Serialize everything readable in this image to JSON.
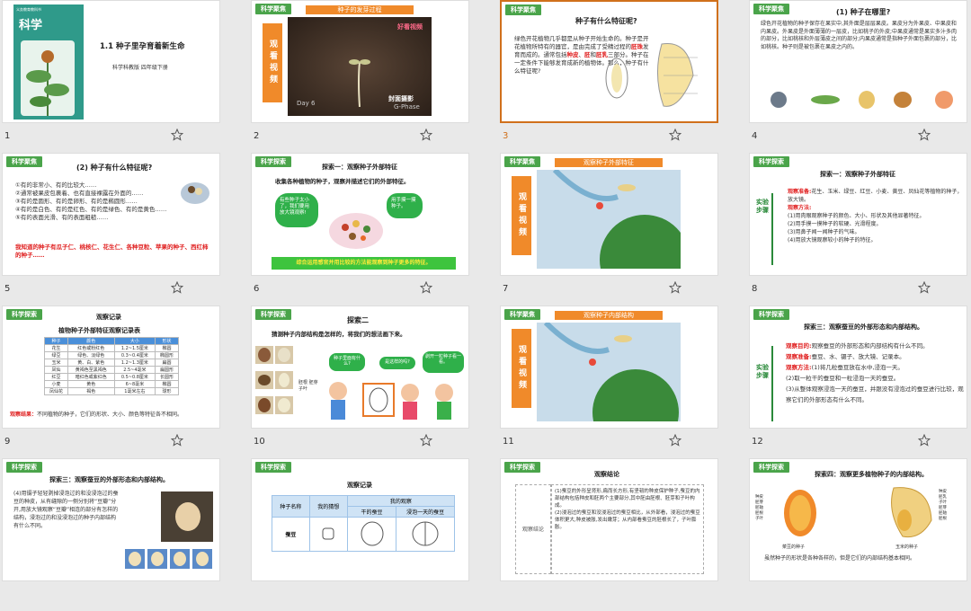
{
  "slides": [
    {
      "num": "1",
      "book_title": "科学",
      "publisher_small": "义务教育教科书",
      "title": "1.1 种子里孕育着新生命",
      "sub": "科学科教版   四年级下册"
    },
    {
      "num": "2",
      "tag": "科学聚焦",
      "bar": "种子的发芽过程",
      "side": "观看视频",
      "video_day": "Day 6",
      "video_credit": "封面摄影",
      "video_brand": "G-Phase",
      "logo": "好看视频"
    },
    {
      "num": "3",
      "tag": "科学聚焦",
      "title": "种子有什么特征呢?",
      "body_a": "绿色开花植物几乎都是从种子开始生命的。种子是开花植物所特有的器官，是由完成了受精过程的",
      "body_r1": "胚珠",
      "body_b": "发育而成的。通常包括",
      "body_r2": "种皮",
      "body_c": "、",
      "body_r3": "胚",
      "body_d": "和",
      "body_r4": "胚乳",
      "body_e": "三部分。种子在一定条件下能够发育成新的植物体。那么，种子有什么特征呢?"
    },
    {
      "num": "4",
      "tag": "科学聚焦",
      "title": "(1) 种子在哪里?",
      "body": "绿色开花植物的种子保存在果实中,其外面是层层果皮。果皮分为外果皮、中果皮和内果皮。外果皮是外面薄薄的一层皮，比如桃子的外皮;中果皮通常是果实多汁多肉的部分，比如桃核和外层薄皮之间的部分;内果皮通常是指种子外面包裹的部分，比如桃核。种子则是被包裹在果皮之内的。"
    },
    {
      "num": "5",
      "tag": "科学聚焦",
      "title": "(2) 种子有什么特征呢?",
      "items": [
        "①有的非常小、有的比较大……",
        "②通常被果皮包裹着、也有直接裸露在外面的……",
        "③有的是圆形、有的是卵形、有的是椭圆形……",
        "④有的是白色、有的是红色、有的是绿色、有的是黄色……",
        "⑤有的表面光滑、有的表面粗糙……"
      ],
      "note": "我知道的种子有瓜子仁、桃核仁、花生仁、各种豆粒、苹果的种子、西红柿的种子……"
    },
    {
      "num": "6",
      "tag": "科学探索",
      "title": "探索一：观察种子外部特征",
      "intro": "收集各种植物的种子，观察并描述它们的外部特征。",
      "bubble_l": "有些种子太小了，我们要用放大镜观察!",
      "bubble_r": "用手摸一摸种子。",
      "banner": "综合运用感官并用比较的方法能观察到种子更多的特征。"
    },
    {
      "num": "7",
      "tag": "科学聚焦",
      "bar": "观察种子外部特征",
      "side": "观看视频"
    },
    {
      "num": "8",
      "tag": "科学探索",
      "title": "探索一：观察种子外部特征",
      "vlabel": "实验步骤",
      "lines": [
        {
          "k": "观察准备:",
          "v": "花生、玉米、绿豆、红豆、小麦、黄豆、凤仙花等植物的种子，放大镜。"
        },
        {
          "k": "观察方法:",
          "v": ""
        },
        {
          "k": "",
          "v": "(1)用肉眼观察种子的颜色、大小、形状及其他显著特征。"
        },
        {
          "k": "",
          "v": "(2)用手摸一摸种子的软硬、光滑程度。"
        },
        {
          "k": "",
          "v": "(3)用鼻子闻一闻种子的气味。"
        },
        {
          "k": "",
          "v": "(4)用放大镜观察较小的种子的特征。"
        }
      ]
    },
    {
      "num": "9",
      "tag": "科学探索",
      "title": "观察记录",
      "subtitle": "植物种子外部特征观察记录表",
      "table": [
        [
          "种子",
          "颜色",
          "大小",
          "形状"
        ],
        [
          "花生",
          "红色或粉红色",
          "1.2~1.5厘米",
          "椭圆"
        ],
        [
          "绿豆",
          "绿色、淡绿色",
          "0.3~0.4厘米",
          "椭圆形"
        ],
        [
          "玉米",
          "黄、白、紫色",
          "1.2~1.3厘米",
          "扁圆"
        ],
        [
          "凤仙",
          "黄褐色至黑褐色",
          "2.5~4毫米",
          "扁圆形"
        ],
        [
          "红豆",
          "暗红色或紫红色",
          "0.5~0.8厘米",
          "长圆形"
        ],
        [
          "小麦",
          "黄色",
          "6~8毫米",
          "椭圆"
        ],
        [
          "凤仙花",
          "褐色",
          "1毫米左右",
          "球形"
        ]
      ],
      "result_k": "观察结果：",
      "result_v": "不同植物的种子，它们的形状、大小、颜色等特征各不相同。"
    },
    {
      "num": "10",
      "tag": "科学探索",
      "title": "探索二",
      "intro": "猜测种子内部结构是怎样的，将我们的想法画下来。",
      "b1": "种子里面有什么?",
      "b2": "是这样的吗?",
      "b3": "剥开一粒种子看一看。",
      "lbl": "胚根 胚芽 子叶"
    },
    {
      "num": "11",
      "tag": "科学聚焦",
      "bar": "观察种子内部结构",
      "side": "观看视频"
    },
    {
      "num": "12",
      "tag": "科学探索",
      "title": "探索三：观察蚕豆的外部形态和内部结构。",
      "vlabel": "实验步骤",
      "lines": [
        {
          "k": "观察目的:",
          "v": "观察蚕豆的外部形态和内部结构有什么不同。"
        },
        {
          "k": "观察准备:",
          "v": "蚕豆、水、镊子、放大镜、记录本。"
        },
        {
          "k": "观察方法:",
          "v": "(1)将几粒蚕豆放在水中,浸泡一天。"
        },
        {
          "k": "",
          "v": "(2)取一粒干的蚕豆和一粒浸泡一天的蚕豆。"
        },
        {
          "k": "",
          "v": "(3)从整体观察浸泡一天的蚕豆，并跟没有浸泡过的蚕豆进行比较，观察它们的外部形态有什么不同。"
        }
      ]
    },
    {
      "num": "",
      "tag": "科学探索",
      "title": "探索三：观察蚕豆的外部形态和内部结构。",
      "body": "(4)用镊子轻轻剥掉浸泡过的和没浸泡过的蚕豆的种皮，从有缝隙的一侧分别将“豆瓣”分开,用放大镜观察“豆瓣”相连的部分有怎样的结构，浸泡过的和没浸泡过的种子内部结构有什么不同。"
    },
    {
      "num": "",
      "tag": "科学探索",
      "title": "观察记录",
      "head": [
        "种子名称",
        "我的猜想",
        "我的观察"
      ],
      "sub": [
        "干的蚕豆",
        "浸泡一天的蚕豆"
      ],
      "row": "蚕豆"
    },
    {
      "num": "",
      "tag": "科学探索",
      "title": "观察结论",
      "left": "观察结论",
      "p1": "(1)蚕豆的外形呈肾形,扁而长方形,有坚韧的种皮保护种子,蚕豆的内部结构包括种皮和胚两个主要部分,其中胚由胚根、胚芽和子叶构成。",
      "p2": "(2)浸泡过的蚕豆和没浸泡过的蚕豆相比，从外部看，浸泡过的蚕豆体积更大,种皮被胀,发出嫩芽；从内部看蚕豆的胚根长了，子叶膨胀。"
    },
    {
      "num": "",
      "tag": "科学探索",
      "title": "探索四：观察更多植物种子的内部结构。",
      "cap_l": "菜豆的种子",
      "cap_r": "玉米的种子",
      "labels_l": [
        "种皮",
        "胚芽",
        "胚轴",
        "胚根",
        "子叶"
      ],
      "labels_r": [
        "种皮",
        "胚乳",
        "子叶",
        "胚芽",
        "胚轴",
        "胚根"
      ],
      "note": "虽然种子的形状是各种各样的，但是它们的内部结构基本相同。"
    }
  ],
  "colors": {
    "tag": "#4aa44a",
    "accent": "#f08a2a",
    "red": "#e02020",
    "selected": "#d0701b"
  },
  "icons": {
    "star": "star-outline-icon"
  }
}
